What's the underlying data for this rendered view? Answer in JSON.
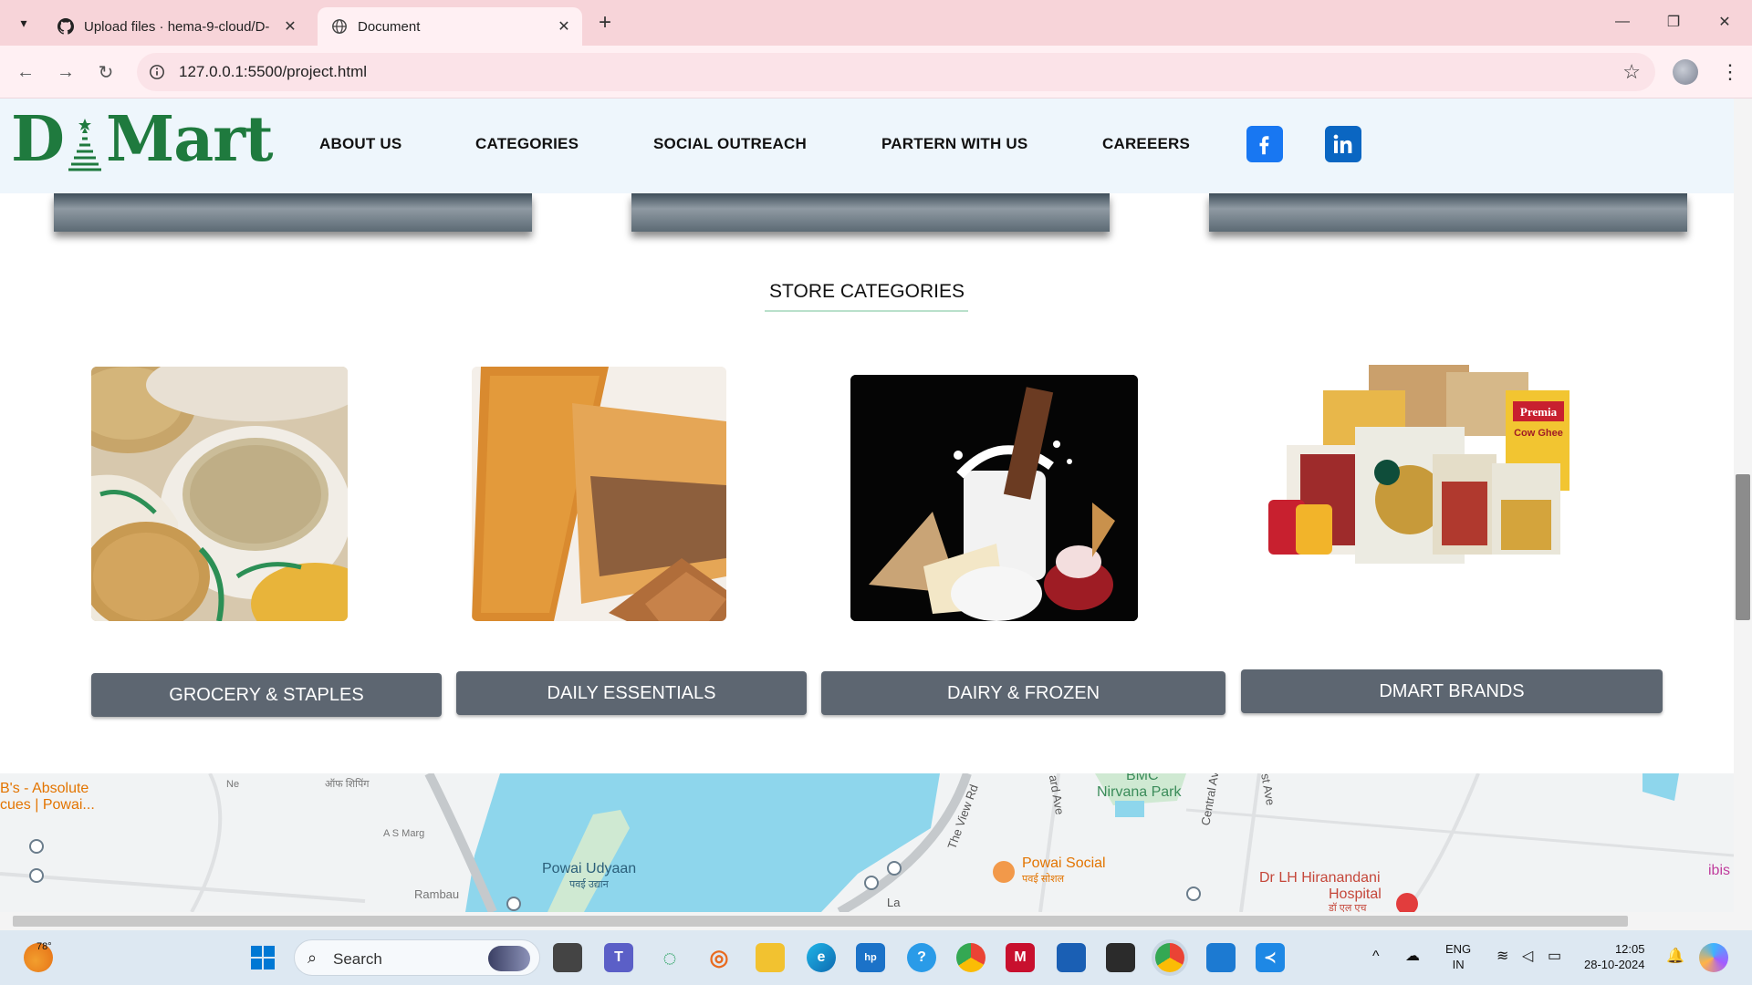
{
  "browser": {
    "tabs": [
      {
        "title": "Upload files · hema-9-cloud/D-",
        "favicon": "github-icon",
        "active": false
      },
      {
        "title": "Document",
        "favicon": "globe-icon",
        "active": true
      }
    ],
    "address": "127.0.0.1:5500/project.html"
  },
  "site": {
    "logo": {
      "left": "D",
      "right": "Mart"
    },
    "nav": [
      "ABOUT US",
      "CATEGORIES",
      "SOCIAL OUTREACH",
      "PARTERN WITH US",
      "CAREEERS"
    ],
    "social": [
      "facebook-icon",
      "linkedin-icon"
    ],
    "section_title": "STORE CATEGORIES",
    "categories": [
      {
        "label": "GROCERY & STAPLES",
        "image": "grocery sacks"
      },
      {
        "label": "DAILY ESSENTIALS",
        "image": "biscuits"
      },
      {
        "label": "DAIRY & FROZEN",
        "image": "milk and dairy"
      },
      {
        "label": "DMART BRANDS",
        "image": "premia packs"
      }
    ],
    "brand_pack_text": {
      "brand": "Premia",
      "product": "Cow Ghee"
    }
  },
  "map": {
    "labels": {
      "absolute": "B's - Absolute",
      "absolute2": "cues | Powai...",
      "shipping": "ऑफ शिपिंग",
      "ne": "Ne",
      "asmarg": "A S Marg",
      "rambau": "Rambau",
      "udyaan": "Powai Udyaan",
      "udyaan_hi": "पवई उद्यान",
      "viewrd": "The View Rd",
      "ardave": "ard Ave",
      "bmc": "BMC",
      "nirvana": "Nirvana Park",
      "central": "Central Av",
      "stave": "st Ave",
      "social": "Powai Social",
      "social_hi": "पवई सोशल",
      "hospital1": "Dr LH Hiranandani",
      "hospital2": "Hospital",
      "hospital_hi": "डॉ एल एच",
      "ibis": "ibis",
      "la": "La"
    }
  },
  "taskbar": {
    "weather": "78°",
    "search": "Search",
    "lang1": "ENG",
    "lang2": "IN",
    "time": "12:05",
    "date": "28-10-2024"
  },
  "colors": {
    "brand_green": "#1f7a3e",
    "header_bg": "#eef6fc",
    "category_button": "#5d6671",
    "tab_strip": "#f7d4d9"
  }
}
